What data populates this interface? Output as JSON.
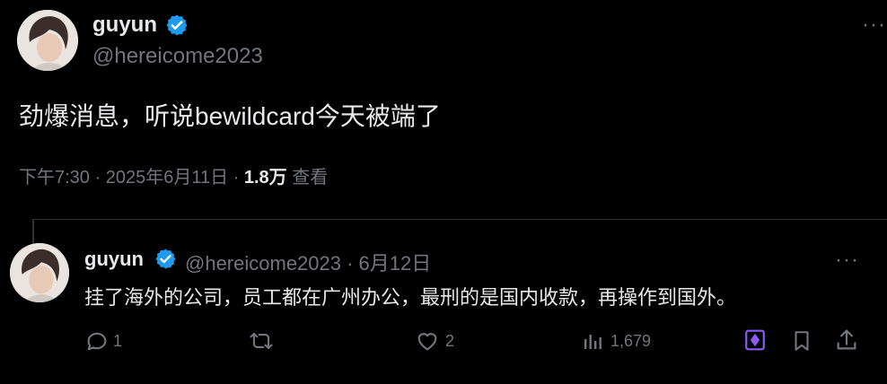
{
  "main_tweet": {
    "display_name": "guyun",
    "handle": "@hereicome2023",
    "text": "劲爆消息，听说bewildcard今天被端了",
    "meta_time": "下午7:30 · 2025年6月11日 · ",
    "views_count": "1.8万",
    "views_label": " 查看",
    "more_icon": "more-icon"
  },
  "reply": {
    "display_name": "guyun",
    "handle_date": "@hereicome2023 · 6月12日",
    "text": "挂了海外的公司，员工都在广州办公，最刑的是国内收款，再操作到国外。",
    "actions": {
      "replies": "1",
      "retweets": "",
      "likes": "2",
      "views": "1,679"
    }
  },
  "colors": {
    "background": "#000000",
    "text": "#e7e9ea",
    "muted": "#71767b",
    "verified": "#1d9bf0",
    "grok": "#8b5cf6"
  }
}
